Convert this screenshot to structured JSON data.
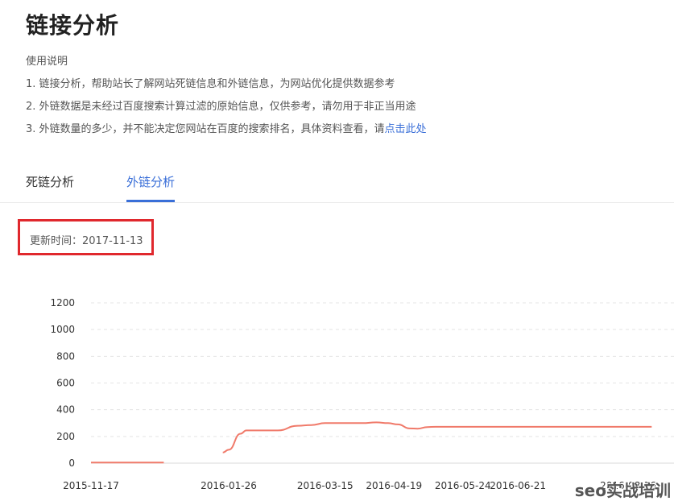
{
  "page": {
    "title": "链接分析"
  },
  "instructions": {
    "heading": "使用说明",
    "line1": "1. 链接分析，帮助站长了解网站死链信息和外链信息，为网站优化提供数据参考",
    "line2": "2. 外链数据是未经过百度搜索计算过滤的原始信息，仅供参考，请勿用于非正当用途",
    "line3_prefix": "3. 外链数量的多少，并不能决定您网站在百度的搜索排名，具体资料查看，请",
    "line3_link": "点击此处"
  },
  "tabs": [
    {
      "label": "死链分析",
      "active": false
    },
    {
      "label": "外链分析",
      "active": true
    }
  ],
  "update": {
    "label": "更新时间：2017-11-13"
  },
  "colors": {
    "accent": "#3a6fd8",
    "line": "#f07a6a",
    "highlight_border": "#e0282d"
  },
  "watermark": "seo实战培训",
  "chart_data": {
    "type": "line",
    "ylim": [
      0,
      1200
    ],
    "yticks": [
      0,
      200,
      400,
      600,
      800,
      1000,
      1200
    ],
    "xtick_labels": [
      "2015-11-17",
      "2016-01-26",
      "2016-03-15",
      "2016-04-19",
      "2016-05-24",
      "2016-06-21",
      "2016-08-16"
    ],
    "grid": true,
    "series": [
      {
        "segments": [
          [
            {
              "x": "2015-11-17",
              "y": 5
            },
            {
              "x": "2015-12-24",
              "y": 5
            }
          ],
          [
            {
              "x": "2016-01-23",
              "y": 80
            },
            {
              "x": "2016-01-26",
              "y": 100
            },
            {
              "x": "2016-02-01",
              "y": 220
            },
            {
              "x": "2016-02-04",
              "y": 245
            },
            {
              "x": "2016-02-10",
              "y": 245
            },
            {
              "x": "2016-02-20",
              "y": 245
            },
            {
              "x": "2016-03-01",
              "y": 280
            },
            {
              "x": "2016-03-08",
              "y": 285
            },
            {
              "x": "2016-03-15",
              "y": 300
            },
            {
              "x": "2016-03-25",
              "y": 300
            },
            {
              "x": "2016-04-03",
              "y": 300
            },
            {
              "x": "2016-04-10",
              "y": 305
            },
            {
              "x": "2016-04-16",
              "y": 300
            },
            {
              "x": "2016-04-21",
              "y": 290
            },
            {
              "x": "2016-04-27",
              "y": 260
            },
            {
              "x": "2016-05-01",
              "y": 258
            },
            {
              "x": "2016-05-06",
              "y": 270
            },
            {
              "x": "2016-05-10",
              "y": 272
            },
            {
              "x": "2016-05-24",
              "y": 272
            },
            {
              "x": "2016-06-21",
              "y": 272
            },
            {
              "x": "2016-07-19",
              "y": 272
            },
            {
              "x": "2016-08-16",
              "y": 272
            },
            {
              "x": "2016-08-28",
              "y": 272
            }
          ]
        ]
      }
    ]
  }
}
